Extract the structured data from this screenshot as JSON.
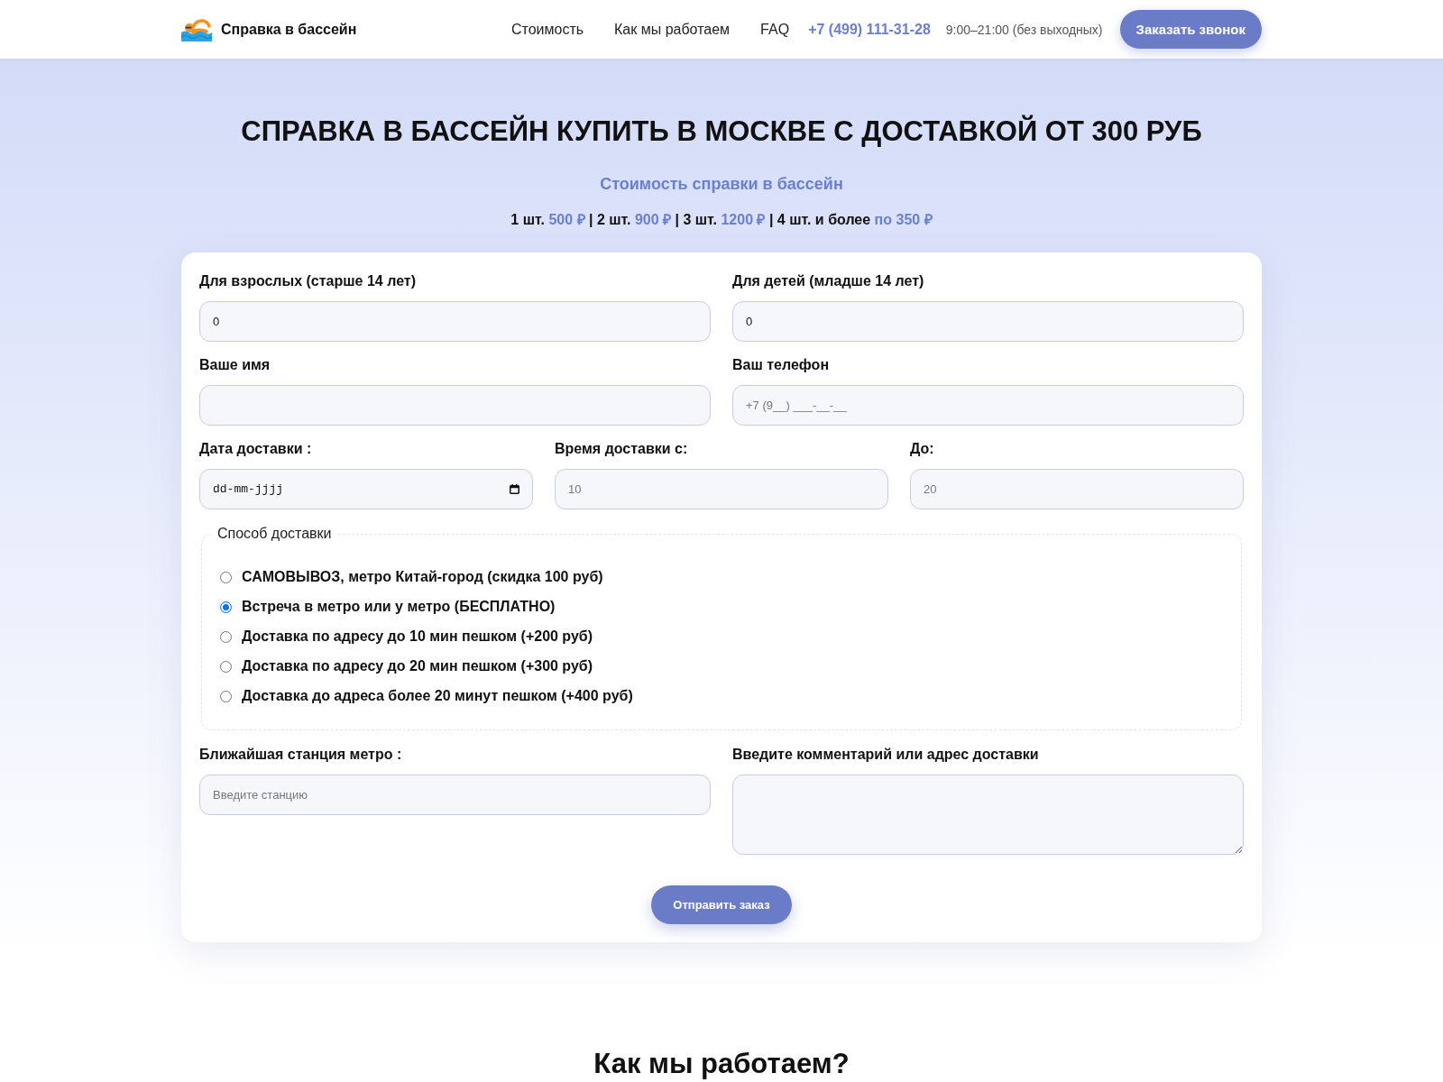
{
  "header": {
    "site_name": "Справка в бассейн",
    "nav": [
      {
        "label": "Стоимость"
      },
      {
        "label": "Как мы работаем"
      },
      {
        "label": "FAQ"
      }
    ],
    "phone": "+7 (499) 111-31-28",
    "hours": "9:00–21:00 (без выходных)",
    "call_button": "Заказать звонок"
  },
  "hero": {
    "title": "СПРАВКА В БАССЕЙН КУПИТЬ В МОСКВЕ С ДОСТАВКОЙ ОТ 300 РУБ",
    "subtitle": "Стоимость справки в бассейн",
    "price_list": [
      {
        "quantity": "1 шт.",
        "price": "500 ₽"
      },
      {
        "separator": "|",
        "quantity": "2 шт.",
        "price": "900 ₽"
      },
      {
        "separator": "|",
        "quantity": "3 шт.",
        "price": "1200 ₽"
      },
      {
        "separator": "|",
        "quantity": "4 шт. и более",
        "price": "по 350 ₽"
      }
    ]
  },
  "form": {
    "rows": [
      {
        "fields": [
          {
            "kind": "input",
            "label": "Для взрослых (старше 14 лет)",
            "value": "0"
          },
          {
            "kind": "input",
            "label": "Для детей (младше 14 лет)",
            "value": "0"
          }
        ]
      },
      {
        "fields": [
          {
            "kind": "input",
            "label": "Ваше имя"
          },
          {
            "kind": "input",
            "label": "Ваш телефон",
            "placeholder": "+7 (9__) ___-__-__"
          }
        ]
      },
      {
        "fields": [
          {
            "kind": "date",
            "label": "Дата доставки :",
            "value": "dd-mm-jjjj"
          },
          {
            "kind": "input",
            "label": "Время доставки с:",
            "placeholder": "10"
          },
          {
            "kind": "input",
            "label": "До:",
            "placeholder": "20"
          }
        ]
      }
    ],
    "delivery": {
      "legend": "Способ доставки",
      "options": [
        {
          "label": "САМОВЫВОЗ, метро Китай-город (скидка 100 руб)",
          "selected": false
        },
        {
          "label": "Встреча в метро или у метро (БЕСПЛАТНО)",
          "selected": true
        },
        {
          "label": "Доставка по адресу до 10 мин пешком (+200 руб)",
          "selected": false
        },
        {
          "label": "Доставка по адресу до 20 мин пешком (+300 руб)",
          "selected": false
        },
        {
          "label": "Доставка до адреса более 20 минут пешком (+400 руб)",
          "selected": false
        }
      ]
    },
    "bottom_fields": [
      {
        "kind": "input",
        "label": "Ближайшая станция метро :",
        "placeholder": "Введите станцию"
      },
      {
        "kind": "textarea",
        "label": "Введите комментарий или адрес доставки"
      }
    ],
    "submit": "Отправить заказ"
  },
  "next_section": {
    "title": "Как мы работаем?"
  }
}
